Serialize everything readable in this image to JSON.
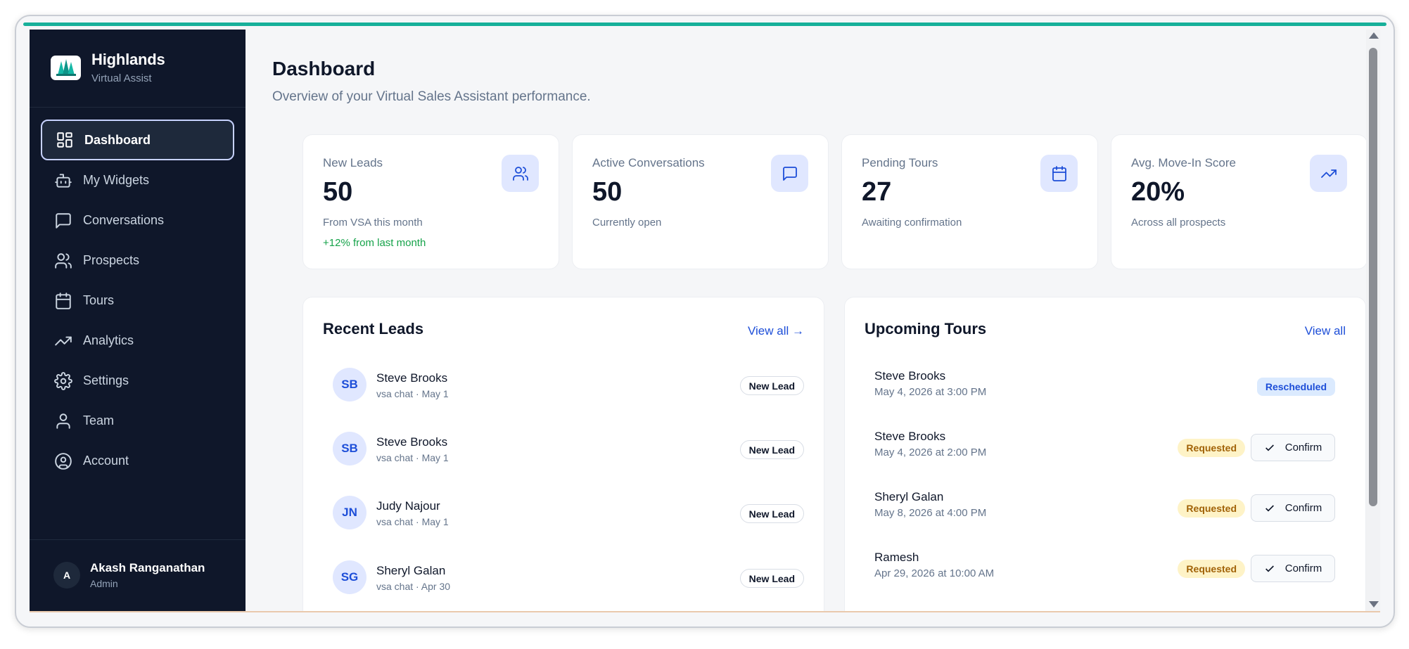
{
  "brand": {
    "name": "Highlands",
    "subtitle": "Virtual Assist",
    "logo_icon": "pine-trees-logo"
  },
  "sidebar": {
    "items": [
      {
        "label": "Dashboard",
        "icon": "layout-grid-icon",
        "active": true
      },
      {
        "label": "My Widgets",
        "icon": "bot-icon"
      },
      {
        "label": "Conversations",
        "icon": "message-square-icon"
      },
      {
        "label": "Prospects",
        "icon": "users-icon"
      },
      {
        "label": "Tours",
        "icon": "calendar-icon"
      },
      {
        "label": "Analytics",
        "icon": "trending-up-icon"
      },
      {
        "label": "Settings",
        "icon": "gear-icon"
      },
      {
        "label": "Team",
        "icon": "user-icon"
      },
      {
        "label": "Account",
        "icon": "user-circle-icon"
      }
    ]
  },
  "user": {
    "initial": "A",
    "name": "Akash Ranganathan",
    "role": "Admin"
  },
  "page": {
    "title": "Dashboard",
    "subtitle": "Overview of your Virtual Sales Assistant performance."
  },
  "stats": [
    {
      "label": "New Leads",
      "value": "50",
      "note": "From VSA this month",
      "delta": "+12% from last month",
      "icon": "users-icon"
    },
    {
      "label": "Active Conversations",
      "value": "50",
      "note": "Currently open",
      "icon": "message-square-icon"
    },
    {
      "label": "Pending Tours",
      "value": "27",
      "note": "Awaiting confirmation",
      "icon": "calendar-icon"
    },
    {
      "label": "Avg. Move-In Score",
      "value": "20%",
      "note": "Across all prospects",
      "icon": "trending-up-icon"
    }
  ],
  "recent_leads": {
    "title": "Recent Leads",
    "view_all": "View all →",
    "items": [
      {
        "initials": "SB",
        "name": "Steve Brooks",
        "meta": "vsa chat · May 1",
        "badge": "New Lead"
      },
      {
        "initials": "SB",
        "name": "Steve Brooks",
        "meta": "vsa chat · May 1",
        "badge": "New Lead"
      },
      {
        "initials": "JN",
        "name": "Judy Najour",
        "meta": "vsa chat · May 1",
        "badge": "New Lead"
      },
      {
        "initials": "SG",
        "name": "Sheryl Galan",
        "meta": "vsa chat · Apr 30",
        "badge": "New Lead"
      }
    ]
  },
  "upcoming_tours": {
    "title": "Upcoming Tours",
    "view_all": "View all",
    "confirm_label": "Confirm",
    "items": [
      {
        "name": "Steve Brooks",
        "time": "May 4, 2026 at 3:00 PM",
        "status": "Rescheduled"
      },
      {
        "name": "Steve Brooks",
        "time": "May 4, 2026 at 2:00 PM",
        "status": "Requested"
      },
      {
        "name": "Sheryl Galan",
        "time": "May 8, 2026 at 4:00 PM",
        "status": "Requested"
      },
      {
        "name": "Ramesh",
        "time": "Apr 29, 2026 at 10:00 AM",
        "status": "Requested"
      }
    ]
  },
  "colors": {
    "accent_bar": "#17b09a",
    "sidebar_bg": "#0f172a",
    "link": "#1d4ed8",
    "positive": "#16a34a"
  }
}
